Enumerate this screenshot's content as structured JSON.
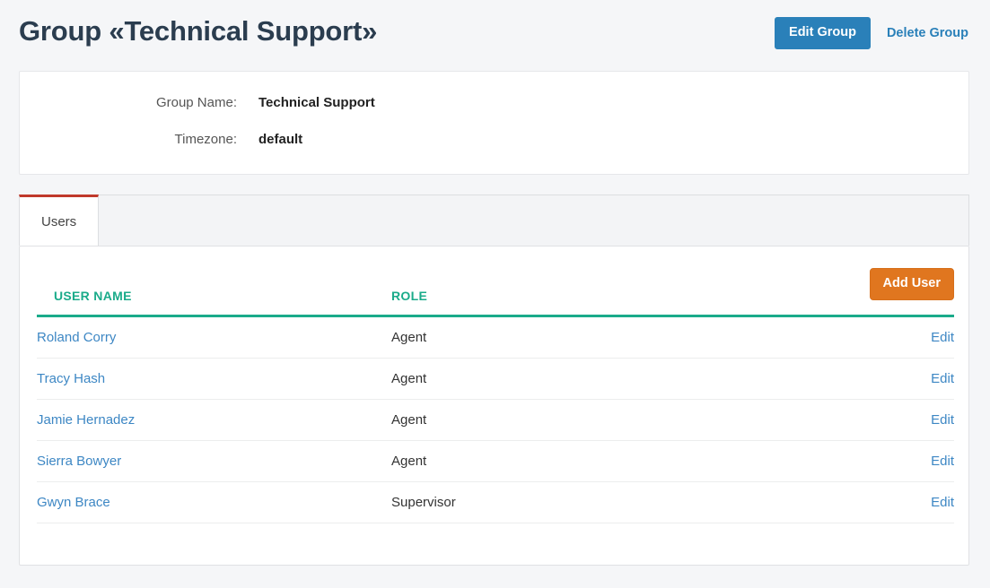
{
  "header": {
    "title": "Group «Technical Support»",
    "edit_group_label": "Edit Group",
    "delete_group_label": "Delete Group",
    "primary_button_color": "#2a80b9",
    "link_color": "#2a80b9"
  },
  "info": {
    "rows": [
      {
        "label": "Group Name:",
        "value": "Technical Support"
      },
      {
        "label": "Timezone:",
        "value": "default"
      }
    ]
  },
  "tabs": {
    "items": [
      {
        "label": "Users",
        "active": true
      }
    ],
    "active_indicator_color": "#c0392b"
  },
  "users_panel": {
    "add_user_label": "Add User",
    "add_user_color": "#e0761f",
    "table": {
      "header_color": "#1aab8a",
      "columns": [
        "USER NAME",
        "ROLE",
        ""
      ],
      "action_label": "Edit",
      "rows": [
        {
          "name": "Roland Corry",
          "role": "Agent",
          "action": "Edit"
        },
        {
          "name": "Tracy Hash",
          "role": "Agent",
          "action": "Edit"
        },
        {
          "name": "Jamie Hernadez",
          "role": "Agent",
          "action": "Edit"
        },
        {
          "name": "Sierra Bowyer",
          "role": "Agent",
          "action": "Edit"
        },
        {
          "name": "Gwyn Brace",
          "role": "Supervisor",
          "action": "Edit"
        }
      ]
    }
  }
}
